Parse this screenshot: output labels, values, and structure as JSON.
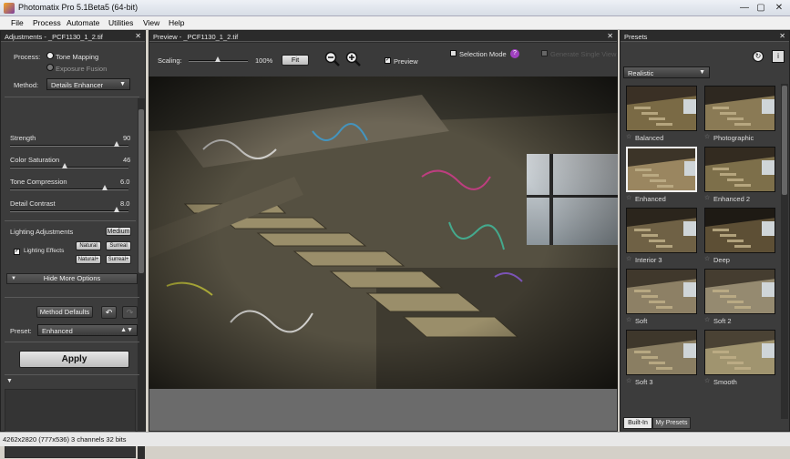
{
  "window": {
    "title": "Photomatix Pro 5.1Beta5 (64-bit)",
    "minimize": "—",
    "maximize": "▢",
    "close": "✕"
  },
  "menu": [
    "File",
    "Process",
    "Automate",
    "Utilities",
    "View",
    "Help"
  ],
  "adjust": {
    "header": "Adjustments - _PCF1130_1_2.tif",
    "close": "✕",
    "process_label": "Process:",
    "process_opt1": "Tone Mapping",
    "process_opt2": "Exposure Fusion",
    "method_label": "Method:",
    "method_value": "Details Enhancer",
    "sliders": [
      {
        "label": "Strength",
        "value": "90",
        "pct": 0.9
      },
      {
        "label": "Color Saturation",
        "value": "46",
        "pct": 0.46
      },
      {
        "label": "Tone Compression",
        "value": "6.0",
        "pct": 0.8
      },
      {
        "label": "Detail Contrast",
        "value": "8.0",
        "pct": 0.9
      }
    ],
    "lighting_label": "Lighting Adjustments",
    "lighting_value": "Medium",
    "lighting_effects": "Lighting Effects",
    "natural": "Natural",
    "surreal": "Surreal",
    "natural_plus": "Natural+",
    "surreal_plus": "Surreal+",
    "hide_more": "Hide More Options",
    "method_defaults": "Method Defaults",
    "preset_label": "Preset:",
    "preset_value": "Enhanced",
    "apply": "Apply"
  },
  "preview": {
    "header": "Preview - _PCF1130_1_2.tif",
    "close": "✕",
    "scaling_label": "Scaling:",
    "scaling_value": "100%",
    "fit": "Fit",
    "preview_label": "Preview",
    "selection_mode": "Selection Mode",
    "help": "?",
    "single_view": "Generate Single View"
  },
  "presets": {
    "header": "Presets",
    "close": "✕",
    "category": "Realistic",
    "items": [
      "Balanced",
      "Photographic",
      "Enhanced",
      "Enhanced 2",
      "Interior 3",
      "Deep",
      "Soft",
      "Soft 2",
      "Soft 3",
      "Smooth"
    ],
    "selected": "Enhanced",
    "tabs": [
      "Built-In",
      "My Presets"
    ]
  },
  "status": "4262x2820 (777x536) 3 channels 32 bits"
}
